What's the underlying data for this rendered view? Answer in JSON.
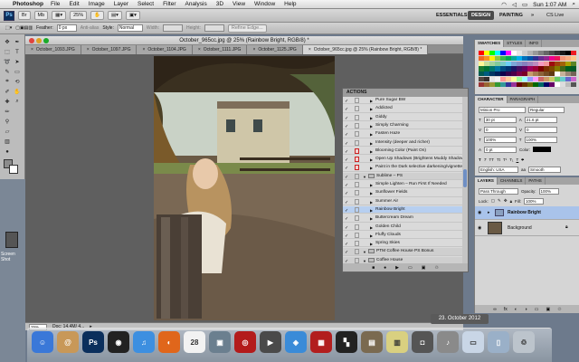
{
  "menubar": {
    "app": "Photoshop",
    "items": [
      "File",
      "Edit",
      "Image",
      "Layer",
      "Select",
      "Filter",
      "Analysis",
      "3D",
      "View",
      "Window",
      "Help"
    ],
    "clock": "Sun 1:07 AM"
  },
  "appbar": {
    "zoom": "25%",
    "workspaces": [
      "ESSENTIALS",
      "DESIGN",
      "PAINTING"
    ],
    "cs_live": "CS Live"
  },
  "options": {
    "feather_label": "Feather:",
    "feather_value": "0 px",
    "antialias": "Anti-alias",
    "style_label": "Style:",
    "style_value": "Normal",
    "width_label": "Width:",
    "height_label": "Height:",
    "refine": "Refine Edge..."
  },
  "document": {
    "title": "October_965cc.jpg @ 25% (Rainbow Bright, RGB/8) *",
    "tabs": [
      "October_1093.JPG",
      "October_1097.JPG",
      "October_1104.JPG",
      "October_1111.JPG",
      "October_1125.JPG",
      "October_965cc.jpg @ 25% (Rainbow Bright, RGB/8) *"
    ],
    "zoom": "25%",
    "doc_info": "Doc: 14.4M/ 4..."
  },
  "actions_panel": {
    "title": "ACTIONS",
    "rows": [
      {
        "label": "Pure Sugar BW",
        "dlg": "none"
      },
      {
        "label": "Addicted",
        "dlg": "none"
      },
      {
        "label": "Giddy",
        "dlg": "none"
      },
      {
        "label": "Simply Charming",
        "dlg": "none"
      },
      {
        "label": "Fasten Haze",
        "dlg": "none"
      },
      {
        "label": "Intensity (deeper and richer)",
        "dlg": "none"
      },
      {
        "label": "Blooming Color (Paint On)",
        "dlg": "red"
      },
      {
        "label": "Open Up Shadows (Brightens Muddy Shadows)",
        "dlg": "red"
      },
      {
        "label": "Paint in the Dark selective darkening/vignette",
        "dlg": "red"
      },
      {
        "label": "Sublime – PS",
        "dlg": "none",
        "set": true
      },
      {
        "label": "Simple Lighten – Run First If Needed",
        "dlg": "none"
      },
      {
        "label": "Sunflower Fields",
        "dlg": "none"
      },
      {
        "label": "Summer Air",
        "dlg": "none"
      },
      {
        "label": "Rainbow Bright",
        "dlg": "none",
        "selected": true
      },
      {
        "label": "Buttercream Dream",
        "dlg": "none"
      },
      {
        "label": "Golden Child",
        "dlg": "none"
      },
      {
        "label": "Fluffy Clouds",
        "dlg": "none"
      },
      {
        "label": "Spring Skies",
        "dlg": "none"
      },
      {
        "label": "PTM Coffee House PS Bonus",
        "dlg": "none",
        "set": true
      },
      {
        "label": "Coffee House",
        "dlg": "none",
        "set": true
      }
    ]
  },
  "swatches": {
    "tabs": [
      "SWATCHES",
      "STYLES",
      "INFO"
    ],
    "colors": [
      "#ff0000",
      "#ffff00",
      "#00ff00",
      "#00ffff",
      "#0000ff",
      "#ff00ff",
      "#ffffff",
      "#e6e6e6",
      "#cccccc",
      "#b3b3b3",
      "#999999",
      "#808080",
      "#666666",
      "#4d4d4d",
      "#333333",
      "#1a1a1a",
      "#000000",
      "#ed1c24",
      "#f26522",
      "#f7941d",
      "#fff200",
      "#8dc63f",
      "#39b54a",
      "#00a651",
      "#00a99d",
      "#00aeef",
      "#0072bc",
      "#0054a6",
      "#2e3192",
      "#662d91",
      "#92278f",
      "#ec008c",
      "#ed145b",
      "#f69679",
      "#f9ad81",
      "#fdc689",
      "#fff799",
      "#c4df9b",
      "#a3d39c",
      "#82ca9c",
      "#7accc8",
      "#6dcff6",
      "#7da7d8",
      "#8393ca",
      "#8781bd",
      "#a186be",
      "#bd8cbf",
      "#f49ac1",
      "#f5989d",
      "#9e0b0f",
      "#a0410d",
      "#a36209",
      "#aba000",
      "#598527",
      "#1a7b30",
      "#007236",
      "#00746b",
      "#0076a3",
      "#004a80",
      "#003471",
      "#1b1464",
      "#440e62",
      "#630460",
      "#9e005d",
      "#9e0039",
      "#790000",
      "#7b2e00",
      "#7d4900",
      "#827b00",
      "#406618",
      "#005e20",
      "#005826",
      "#005952",
      "#005b7f",
      "#003663",
      "#002157",
      "#0d004c",
      "#32004b",
      "#4b0049",
      "#7b0046",
      "#7a0026",
      "#c69c6d",
      "#a67c52",
      "#8c6239",
      "#754c24",
      "#603913",
      "#ffffff",
      "#c7b299",
      "#998675",
      "#736357",
      "#534741",
      "#362f2d",
      "#e6e6e6",
      "#f2f2f2",
      "#ff9999",
      "#ffcc99",
      "#ffff99",
      "#99ff99",
      "#99ffff",
      "#9999ff",
      "#ff99ff",
      "#cc6666",
      "#cc9966",
      "#cccc66",
      "#66cc66",
      "#66cccc",
      "#6666cc",
      "#cc66cc",
      "#993333",
      "#996633",
      "#999933",
      "#339933",
      "#339999",
      "#333399",
      "#993399",
      "#660000",
      "#663300",
      "#666600",
      "#006600",
      "#006666",
      "#000066",
      "#660066",
      "#ffffff",
      "#dddddd",
      "#bbbbbb",
      "#555555"
    ]
  },
  "character": {
    "tabs": [
      "CHARACTER",
      "PARAGRAPH"
    ],
    "font": "Minion Pro",
    "style": "Regular",
    "size": "30 pt",
    "leading": "21.6 pt",
    "kerning": "0",
    "scale_v": "100%",
    "scale_h": "100%",
    "baseline": "0 pt",
    "color_label": "Color:",
    "language": "English: USA",
    "aa": "Smooth",
    "tracking": "0"
  },
  "layers": {
    "tabs": [
      "LAYERS",
      "CHANNELS",
      "PATHS"
    ],
    "blend": "Pass Through",
    "opacity_label": "Opacity:",
    "opacity": "100%",
    "lock_label": "Lock:",
    "fill_label": "Fill:",
    "fill": "100%",
    "items": [
      {
        "label": "Rainbow Bright",
        "selected": true
      },
      {
        "label": "Background",
        "selected": false
      }
    ]
  },
  "desktop": {
    "date_tip": "23. October 2012",
    "file_label": "Screen Shot"
  },
  "dock": {
    "icons": [
      {
        "name": "finder-icon",
        "color": "#3a78d8",
        "glyph": "☺"
      },
      {
        "name": "address-book-icon",
        "color": "#c89858",
        "glyph": "@"
      },
      {
        "name": "photoshop-icon",
        "color": "#0b2f5c",
        "glyph": "Ps"
      },
      {
        "name": "dvd-player-icon",
        "color": "#222222",
        "glyph": "◉"
      },
      {
        "name": "itunes-icon",
        "color": "#3d8fe0",
        "glyph": "♫"
      },
      {
        "name": "firefox-icon",
        "color": "#e0661b",
        "glyph": "◐"
      },
      {
        "name": "ical-icon",
        "color": "#f2f2f2",
        "glyph": "28"
      },
      {
        "name": "iphoto-icon",
        "color": "#6b7f8f",
        "glyph": "▣"
      },
      {
        "name": "photo-booth-icon",
        "color": "#b31b1b",
        "glyph": "◎"
      },
      {
        "name": "facetime-icon",
        "color": "#4a4a4a",
        "glyph": "▶"
      },
      {
        "name": "safari-icon",
        "color": "#3a8bd8",
        "glyph": "◈"
      },
      {
        "name": "film-icon",
        "color": "#b21e1e",
        "glyph": "▦"
      },
      {
        "name": "grid-app-icon",
        "color": "#222222",
        "glyph": "▚"
      },
      {
        "name": "preview-icon",
        "color": "#7a6a50",
        "glyph": "▤"
      },
      {
        "name": "stickies-icon",
        "color": "#d9d080",
        "glyph": "▥"
      },
      {
        "name": "image-capture-icon",
        "color": "#555555",
        "glyph": "◘"
      },
      {
        "name": "itunes-folder-icon",
        "color": "#8a8a8a",
        "glyph": "♪"
      },
      {
        "name": "document-icon",
        "color": "#c9d6e6",
        "glyph": "▭"
      },
      {
        "name": "pdf-icon",
        "color": "#9ab0c8",
        "glyph": "▯"
      },
      {
        "name": "trash-icon",
        "color": "#bcc4cc",
        "glyph": "♲"
      }
    ]
  }
}
